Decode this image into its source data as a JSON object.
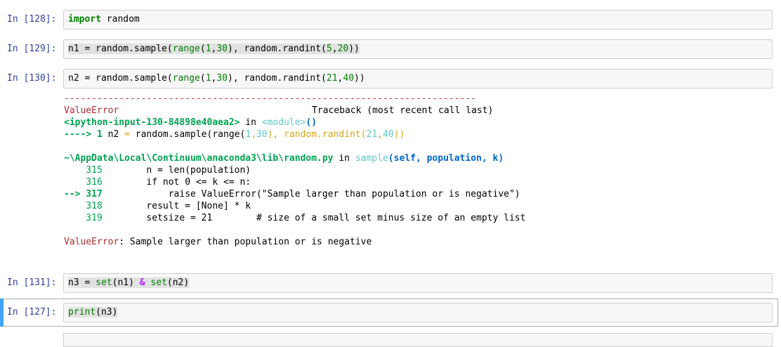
{
  "cells": [
    {
      "prompt": "In [128]:",
      "code": [
        {
          "t": "import",
          "c": "kw"
        },
        {
          "t": " random",
          "c": "txt"
        }
      ]
    },
    {
      "prompt": "In [129]:",
      "code": [
        {
          "t": "n1 = random.sample(",
          "c": "txt"
        },
        {
          "t": "range",
          "c": "bi"
        },
        {
          "t": "(",
          "c": "txt"
        },
        {
          "t": "1",
          "c": "num"
        },
        {
          "t": ",",
          "c": "txt"
        },
        {
          "t": "30",
          "c": "num"
        },
        {
          "t": "), random.randint(",
          "c": "txt"
        },
        {
          "t": "5",
          "c": "num"
        },
        {
          "t": ",",
          "c": "txt"
        },
        {
          "t": "20",
          "c": "num"
        },
        {
          "t": "))",
          "c": "txt"
        }
      ]
    },
    {
      "prompt": "In [130]:",
      "code": [
        {
          "t": "n2 = random.sample(",
          "c": "txt"
        },
        {
          "t": "range",
          "c": "bi"
        },
        {
          "t": "(",
          "c": "txt"
        },
        {
          "t": "1",
          "c": "num"
        },
        {
          "t": ",",
          "c": "txt"
        },
        {
          "t": "30",
          "c": "num"
        },
        {
          "t": "), random.randint(",
          "c": "txt"
        },
        {
          "t": "21",
          "c": "num"
        },
        {
          "t": ",",
          "c": "txt"
        },
        {
          "t": "40",
          "c": "num"
        },
        {
          "t": "))",
          "c": "txt"
        }
      ]
    },
    {
      "prompt": "In [131]:",
      "code": [
        {
          "t": "n3 = ",
          "c": "txt"
        },
        {
          "t": "set",
          "c": "bi"
        },
        {
          "t": "(n1) ",
          "c": "txt"
        },
        {
          "t": "&",
          "c": "op"
        },
        {
          "t": " ",
          "c": "txt"
        },
        {
          "t": "set",
          "c": "bi"
        },
        {
          "t": "(n2)",
          "c": "txt"
        }
      ]
    },
    {
      "prompt": "In [127]:",
      "code": [
        {
          "t": "print",
          "c": "bi"
        },
        {
          "t": "(n3)",
          "c": "txt"
        }
      ]
    }
  ],
  "traceback": {
    "separator": "---------------------------------------------------------------------------",
    "error_name": "ValueError",
    "header_right": "Traceback (most recent call last)",
    "frame1_file": "<ipython-input-130-84898e40aea2>",
    "frame1_in": " in ",
    "frame1_func": "<module>",
    "frame1_parens": "()",
    "frame1_arrow": "----> 1 ",
    "frame1_code_a": "n2 ",
    "frame1_eq": "=",
    "frame1_code_b": " random.sample(range(",
    "frame1_n1": "1",
    "frame1_comma1": ",",
    "frame1_n30": "30",
    "frame1_code_c": "), random.randint(",
    "frame1_n21": "21",
    "frame1_comma2": ",",
    "frame1_n40": "40",
    "frame1_code_d": "))",
    "frame2_path": "~\\AppData\\Local\\Continuum\\anaconda3\\lib\\random.py",
    "frame2_in": " in ",
    "frame2_func": "sample",
    "frame2_sig": "(self, population, k)",
    "lines": [
      {
        "gutter": "    315",
        "code": "        n = len(population)"
      },
      {
        "gutter": "    316",
        "code": "        if not 0 <= k <= n:"
      },
      {
        "gutter": "--> 317",
        "code": "            raise ValueError(\"Sample larger than population or is negative\")"
      },
      {
        "gutter": "    318",
        "code": "        result = [None] * k"
      },
      {
        "gutter": "    319",
        "code": "        setsize = 21        # size of a small set minus size of an empty list"
      }
    ],
    "final_name": "ValueError",
    "final_msg": ": Sample larger than population or is negative"
  }
}
